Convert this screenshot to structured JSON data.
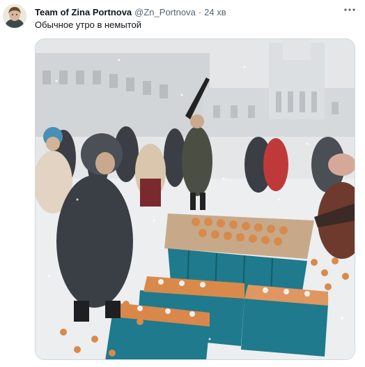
{
  "tweet": {
    "author": {
      "display_name": "Team of Zina Portnova",
      "handle": "@Zn_Portnova",
      "separator": "·",
      "time": "24 хв"
    },
    "text": "Обычное утро в немытой",
    "more_icon": "more-horizontal-icon",
    "media": {
      "kind": "photo",
      "colors": {
        "sky": "#e6e7e8",
        "snow": "#f3f4f5",
        "crate": "#1e7a8c",
        "egg": "#d98a4a"
      }
    }
  }
}
